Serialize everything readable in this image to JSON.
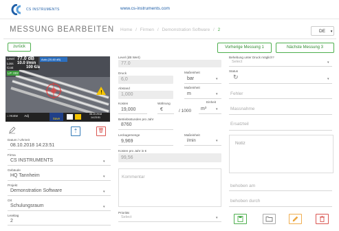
{
  "brand": {
    "logo_text": "CS INSTRUMENTS",
    "url": "www.cs-instruments.com"
  },
  "page": {
    "title": "MESSUNG BEARBEITEN"
  },
  "breadcrumb": [
    {
      "label": "Home"
    },
    {
      "label": "Firmen"
    },
    {
      "label": "Demonstration Software"
    },
    {
      "label": "2"
    }
  ],
  "language": {
    "value": "DE"
  },
  "buttons": {
    "back": "zurück",
    "prev": "Vorherige Messung 1",
    "next": "Nächste Messung 3"
  },
  "photo": {
    "level_label": "Level",
    "level_value": "77.0 dB",
    "auto_label": "Auto (20-60 dB)",
    "loss_label": "Loss",
    "loss_value": "10.0 l/min",
    "cost_label": "Cost",
    "cost_value": "100 €/a",
    "lp_label": "LP: 002",
    "home_label": "Home",
    "adj_label": "Adj",
    "save_label": "Save",
    "date_label": "06.10.2018",
    "time_label": "14:23:51"
  },
  "left": {
    "date_label": "Datum / Uhrzeit",
    "date_value": "08.10.2018 14:23:51",
    "firma_label": "Firma",
    "firma_value": "CS INSTRUMENTS",
    "gebaeude_label": "Gebäude",
    "gebaeude_value": "HQ Tannheim",
    "projekt_label": "Projekt",
    "projekt_value": "Demonstration Software",
    "ort_label": "Ort",
    "ort_value": "Schulungsraum",
    "leaktag_label": "Leaktag",
    "leaktag_value": "2"
  },
  "middle": {
    "level_label": "Level (dB Wert)",
    "level_value": "77.0",
    "druck_label": "Druck",
    "druck_value": "6,0",
    "druck_unit_label": "Maßeinheit",
    "druck_unit_value": "bar",
    "abstand_label": "Abstand",
    "abstand_value": "1,000",
    "abstand_unit_label": "Maßeinheit",
    "abstand_unit_value": "m",
    "kosten_label": "Kosten",
    "kosten_value": "19,000",
    "waehrung_label": "Währung",
    "waehrung_value": "€",
    "per_label": "/ 1000",
    "einheit_label": "Einheit",
    "einheit_value": "m³",
    "betrieb_label": "Betriebsstunden pro Jahr",
    "betrieb_value": "8760",
    "leck_label": "Leckagemenge",
    "leck_value": "9,969",
    "leck_unit_label": "Maßeinheit",
    "leck_unit_value": "l/min",
    "kostenjahr_label": "Kosten pro Jahr in €",
    "kostenjahr_value": "99,56",
    "kommentar_placeholder": "Kommentar",
    "prio_label": "Priorität",
    "prio_value": "Select"
  },
  "right": {
    "behebung_label": "Behebung unter Druck möglich?",
    "behebung_value": "Select",
    "status_label": "Status",
    "fehler_placeholder": "Fehler",
    "massnahme_placeholder": "Massnahme",
    "ersatzteil_placeholder": "Ersatzteil",
    "notiz_placeholder": "Notiz",
    "behoben_am_placeholder": "behoben am",
    "behoben_durch_placeholder": "behoben durch"
  },
  "colors": {
    "accent": "#4cae4c",
    "danger": "#d9534f",
    "brand": "#1f5fa8",
    "info": "#337ab7",
    "warning": "#f0ad4e"
  }
}
